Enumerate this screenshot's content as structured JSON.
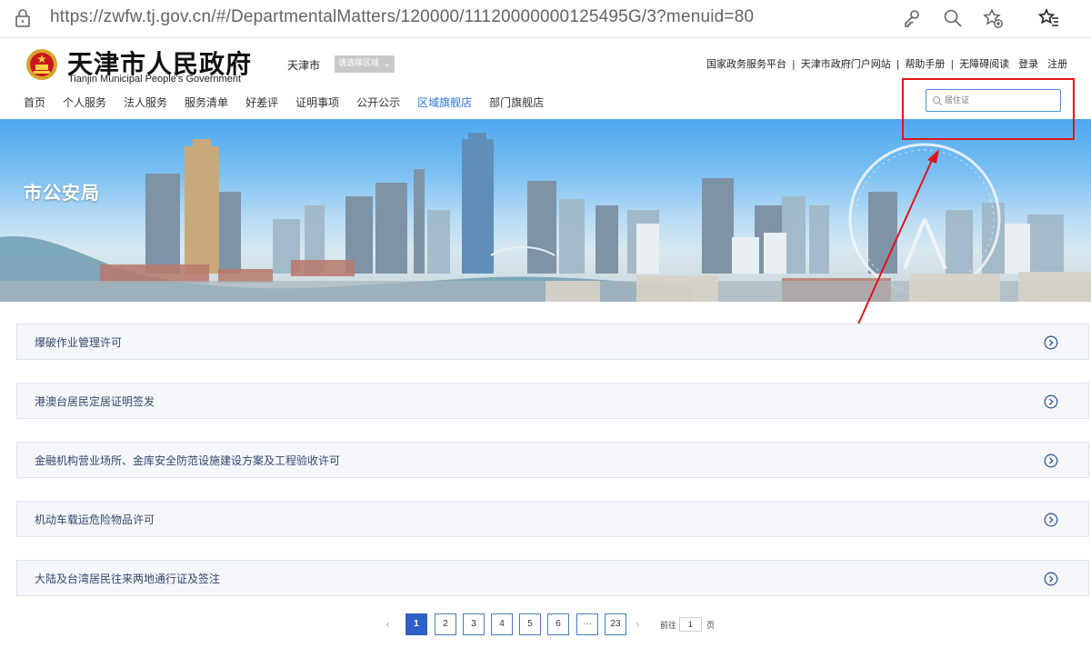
{
  "browser": {
    "url": "https://zwfw.tj.gov.cn/#/DepartmentalMatters/120000/11120000000125495G/3?menuid=80"
  },
  "header": {
    "title": "天津市人民政府",
    "subtitle": "Tianjin Municipal People's Government",
    "city": "天津市",
    "region_select": "请选择区域",
    "top_links": [
      "国家政务服务平台",
      "天津市政府门户网站",
      "帮助手册",
      "无障碍阅读",
      "登录",
      "注册"
    ],
    "search_placeholder": "居住证"
  },
  "nav": {
    "items": [
      "首页",
      "个人服务",
      "法人服务",
      "服务清单",
      "好差评",
      "证明事项",
      "公开公示",
      "区域旗舰店",
      "部门旗舰店"
    ],
    "active_index": 7
  },
  "banner": {
    "title": "市公安局"
  },
  "list": {
    "items": [
      "爆破作业管理许可",
      "港澳台居民定居证明签发",
      "金融机构营业场所、金库安全防范设施建设方案及工程验收许可",
      "机动车载运危险物品许可",
      "大陆及台湾居民往来两地通行证及签注"
    ]
  },
  "pagination": {
    "pages": [
      "1",
      "2",
      "3",
      "4",
      "5",
      "6",
      "···",
      "23"
    ],
    "current": "1",
    "prev": "‹",
    "next": "›",
    "goto_prefix": "前往",
    "goto_value": "1",
    "goto_suffix": "页"
  },
  "colors": {
    "accent": "#2b73d6",
    "highlight_box": "#e0141b",
    "pager_active": "#2f5fc7"
  }
}
